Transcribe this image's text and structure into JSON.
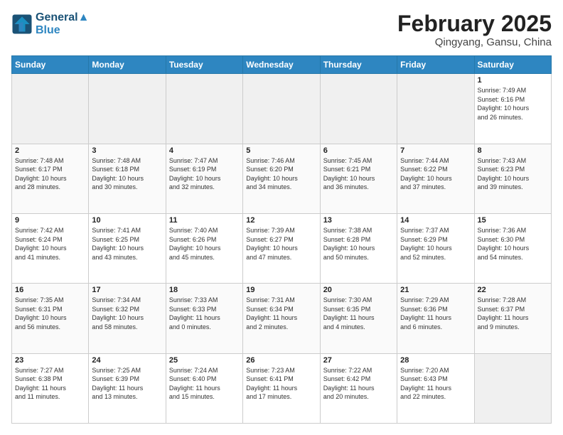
{
  "header": {
    "logo_line1": "General",
    "logo_line2": "Blue",
    "month_title": "February 2025",
    "subtitle": "Qingyang, Gansu, China"
  },
  "weekdays": [
    "Sunday",
    "Monday",
    "Tuesday",
    "Wednesday",
    "Thursday",
    "Friday",
    "Saturday"
  ],
  "weeks": [
    [
      {
        "num": "",
        "info": "",
        "empty": true
      },
      {
        "num": "",
        "info": "",
        "empty": true
      },
      {
        "num": "",
        "info": "",
        "empty": true
      },
      {
        "num": "",
        "info": "",
        "empty": true
      },
      {
        "num": "",
        "info": "",
        "empty": true
      },
      {
        "num": "",
        "info": "",
        "empty": true
      },
      {
        "num": "1",
        "info": "Sunrise: 7:49 AM\nSunset: 6:16 PM\nDaylight: 10 hours\nand 26 minutes.",
        "empty": false
      }
    ],
    [
      {
        "num": "2",
        "info": "Sunrise: 7:48 AM\nSunset: 6:17 PM\nDaylight: 10 hours\nand 28 minutes.",
        "empty": false
      },
      {
        "num": "3",
        "info": "Sunrise: 7:48 AM\nSunset: 6:18 PM\nDaylight: 10 hours\nand 30 minutes.",
        "empty": false
      },
      {
        "num": "4",
        "info": "Sunrise: 7:47 AM\nSunset: 6:19 PM\nDaylight: 10 hours\nand 32 minutes.",
        "empty": false
      },
      {
        "num": "5",
        "info": "Sunrise: 7:46 AM\nSunset: 6:20 PM\nDaylight: 10 hours\nand 34 minutes.",
        "empty": false
      },
      {
        "num": "6",
        "info": "Sunrise: 7:45 AM\nSunset: 6:21 PM\nDaylight: 10 hours\nand 36 minutes.",
        "empty": false
      },
      {
        "num": "7",
        "info": "Sunrise: 7:44 AM\nSunset: 6:22 PM\nDaylight: 10 hours\nand 37 minutes.",
        "empty": false
      },
      {
        "num": "8",
        "info": "Sunrise: 7:43 AM\nSunset: 6:23 PM\nDaylight: 10 hours\nand 39 minutes.",
        "empty": false
      }
    ],
    [
      {
        "num": "9",
        "info": "Sunrise: 7:42 AM\nSunset: 6:24 PM\nDaylight: 10 hours\nand 41 minutes.",
        "empty": false
      },
      {
        "num": "10",
        "info": "Sunrise: 7:41 AM\nSunset: 6:25 PM\nDaylight: 10 hours\nand 43 minutes.",
        "empty": false
      },
      {
        "num": "11",
        "info": "Sunrise: 7:40 AM\nSunset: 6:26 PM\nDaylight: 10 hours\nand 45 minutes.",
        "empty": false
      },
      {
        "num": "12",
        "info": "Sunrise: 7:39 AM\nSunset: 6:27 PM\nDaylight: 10 hours\nand 47 minutes.",
        "empty": false
      },
      {
        "num": "13",
        "info": "Sunrise: 7:38 AM\nSunset: 6:28 PM\nDaylight: 10 hours\nand 50 minutes.",
        "empty": false
      },
      {
        "num": "14",
        "info": "Sunrise: 7:37 AM\nSunset: 6:29 PM\nDaylight: 10 hours\nand 52 minutes.",
        "empty": false
      },
      {
        "num": "15",
        "info": "Sunrise: 7:36 AM\nSunset: 6:30 PM\nDaylight: 10 hours\nand 54 minutes.",
        "empty": false
      }
    ],
    [
      {
        "num": "16",
        "info": "Sunrise: 7:35 AM\nSunset: 6:31 PM\nDaylight: 10 hours\nand 56 minutes.",
        "empty": false
      },
      {
        "num": "17",
        "info": "Sunrise: 7:34 AM\nSunset: 6:32 PM\nDaylight: 10 hours\nand 58 minutes.",
        "empty": false
      },
      {
        "num": "18",
        "info": "Sunrise: 7:33 AM\nSunset: 6:33 PM\nDaylight: 11 hours\nand 0 minutes.",
        "empty": false
      },
      {
        "num": "19",
        "info": "Sunrise: 7:31 AM\nSunset: 6:34 PM\nDaylight: 11 hours\nand 2 minutes.",
        "empty": false
      },
      {
        "num": "20",
        "info": "Sunrise: 7:30 AM\nSunset: 6:35 PM\nDaylight: 11 hours\nand 4 minutes.",
        "empty": false
      },
      {
        "num": "21",
        "info": "Sunrise: 7:29 AM\nSunset: 6:36 PM\nDaylight: 11 hours\nand 6 minutes.",
        "empty": false
      },
      {
        "num": "22",
        "info": "Sunrise: 7:28 AM\nSunset: 6:37 PM\nDaylight: 11 hours\nand 9 minutes.",
        "empty": false
      }
    ],
    [
      {
        "num": "23",
        "info": "Sunrise: 7:27 AM\nSunset: 6:38 PM\nDaylight: 11 hours\nand 11 minutes.",
        "empty": false
      },
      {
        "num": "24",
        "info": "Sunrise: 7:25 AM\nSunset: 6:39 PM\nDaylight: 11 hours\nand 13 minutes.",
        "empty": false
      },
      {
        "num": "25",
        "info": "Sunrise: 7:24 AM\nSunset: 6:40 PM\nDaylight: 11 hours\nand 15 minutes.",
        "empty": false
      },
      {
        "num": "26",
        "info": "Sunrise: 7:23 AM\nSunset: 6:41 PM\nDaylight: 11 hours\nand 17 minutes.",
        "empty": false
      },
      {
        "num": "27",
        "info": "Sunrise: 7:22 AM\nSunset: 6:42 PM\nDaylight: 11 hours\nand 20 minutes.",
        "empty": false
      },
      {
        "num": "28",
        "info": "Sunrise: 7:20 AM\nSunset: 6:43 PM\nDaylight: 11 hours\nand 22 minutes.",
        "empty": false
      },
      {
        "num": "",
        "info": "",
        "empty": true
      }
    ]
  ]
}
